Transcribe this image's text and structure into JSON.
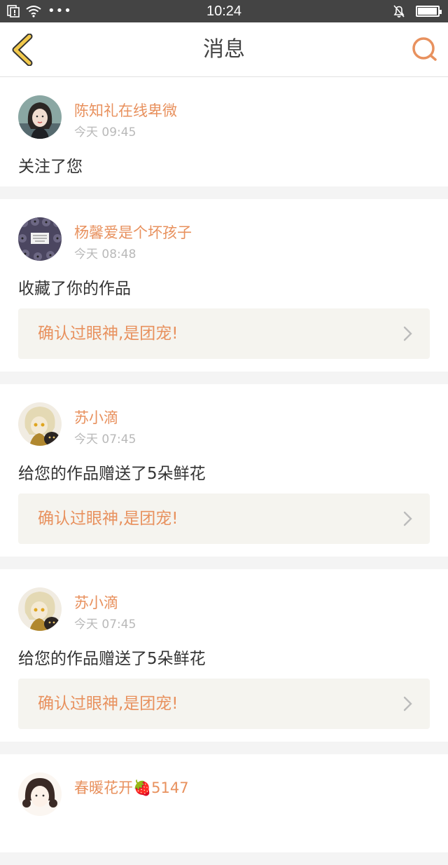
{
  "status_bar": {
    "time": "10:24",
    "dots": "•••",
    "battery_level": 0.95
  },
  "nav": {
    "title": "消息",
    "back_icon": "chevron-left-icon",
    "search_icon": "search-icon"
  },
  "colors": {
    "accent": "#e8915e",
    "back_arrow": "#f2c94c",
    "background": "#f4f4f4"
  },
  "messages": [
    {
      "user": "陈知礼在线卑微",
      "time": "今天 09:45",
      "action": "关注了您",
      "work_title": ""
    },
    {
      "user": "杨馨爱是个坏孩子",
      "time": "今天 08:48",
      "action": "收藏了你的作品",
      "work_title": "确认过眼神,是团宠!"
    },
    {
      "user": "苏小滴",
      "time": "今天 07:45",
      "action": "给您的作品赠送了5朵鲜花",
      "work_title": "确认过眼神,是团宠!"
    },
    {
      "user": "苏小滴",
      "time": "今天 07:45",
      "action": "给您的作品赠送了5朵鲜花",
      "work_title": "确认过眼神,是团宠!"
    },
    {
      "user": "春暖花开",
      "user_badge": "🍓",
      "user_suffix": "5147",
      "time": "",
      "action": "",
      "work_title": ""
    }
  ]
}
